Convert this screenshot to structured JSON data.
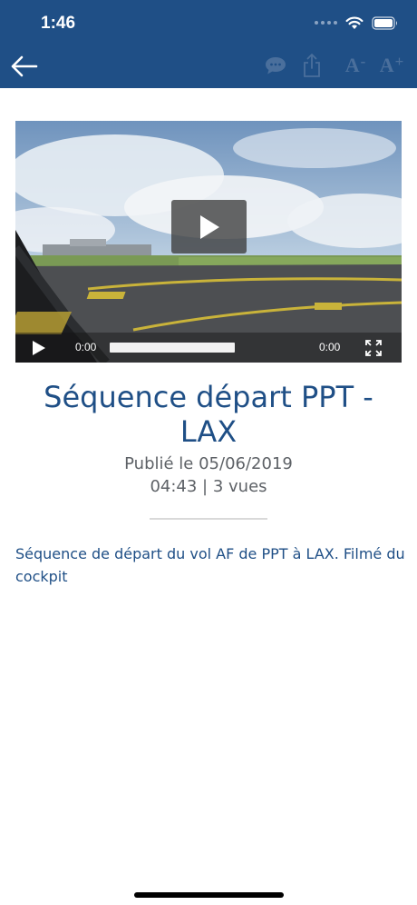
{
  "status_bar": {
    "time": "1:46"
  },
  "nav": {
    "back_icon": "back-arrow-icon",
    "comment_icon": "comment-icon",
    "share_icon": "share-icon",
    "font_decrease_label": "A",
    "font_decrease_sign": "-",
    "font_increase_label": "A",
    "font_increase_sign": "+"
  },
  "video": {
    "current_time": "0:00",
    "total_time": "0:00",
    "progress": 0,
    "play_icon": "play-icon",
    "fullscreen_icon": "fullscreen-icon"
  },
  "article": {
    "title": "Séquence départ PPT - LAX",
    "published": "Publié le 05/06/2019",
    "stats": "04:43 | 3 vues",
    "description": "Séquence de départ du vol AF de PPT à LAX. Filmé du cockpit"
  },
  "colors": {
    "header_bg": "#1f4f86",
    "title": "#1f4f86",
    "meta": "#5d6166",
    "icon_muted": "#4a6f9c"
  }
}
